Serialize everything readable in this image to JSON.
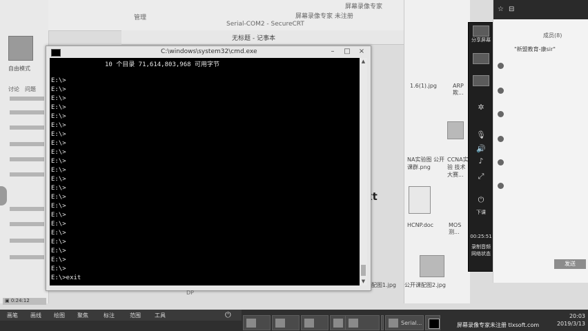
{
  "cmd": {
    "title": "C:\\windows\\system32\\cmd.exe",
    "summary_line": "10 个目录 71,614,803,968 可用字节",
    "prompts": [
      "E:\\>",
      "E:\\>",
      "E:\\>",
      "E:\\>",
      "E:\\>",
      "E:\\>",
      "E:\\>",
      "E:\\>",
      "E:\\>",
      "E:\\>",
      "E:\\>",
      "E:\\>",
      "E:\\>",
      "E:\\>",
      "E:\\>",
      "E:\\>",
      "E:\\>",
      "E:\\>",
      "E:\\>",
      "E:\\>",
      "E:\\>",
      "E:\\>"
    ],
    "last_line": "E:\\>exit",
    "buttons": {
      "minimize": "–",
      "maximize": "□",
      "close": "×"
    }
  },
  "notepad": {
    "title": "无标题 - 记事本"
  },
  "top_strip": {
    "items": [
      "Serial-COM2 - SecureCRT",
      "管理",
      "屏幕录像专家 未注册",
      "屏幕录像专家"
    ]
  },
  "left_pane": {
    "user": "自由模式",
    "tabs": [
      "讨论",
      "问题"
    ]
  },
  "files": [
    {
      "name": "1.6(1).jpg"
    },
    {
      "name": "ARP欺..."
    },
    {
      "name": "NA实验图 公开课群.png"
    },
    {
      "name": "CCNA实验 技术大赛..."
    },
    {
      "name": "HCNP.doc"
    },
    {
      "name": "MOS测..."
    },
    {
      "name": "配图1.jpg"
    },
    {
      "name": "公开课配图2.jpg"
    }
  ],
  "big_letters": [
    "?",
    "xt"
  ],
  "dp_label": "DP",
  "status_left": "▣ 0:24:12",
  "recorder": {
    "labels": [
      "分享屏幕",
      "下课"
    ],
    "timer": "00:25:51",
    "footer": "录制音频 网络状态"
  },
  "chat": {
    "header": [
      "☆",
      "⊟",
      "成员(8)"
    ],
    "group_title": "\"新盟教育-康sir\"",
    "members": [
      "  ",
      "  ",
      "  ",
      "  ",
      "  ",
      "  "
    ],
    "send_label": "发送"
  },
  "taskbar": {
    "menu": [
      "画笔",
      "画线",
      "绘图",
      "聚焦",
      "标注",
      "范围",
      "工具"
    ],
    "tasks": [
      "",
      "",
      "",
      "",
      "",
      "",
      "Serial...",
      ""
    ],
    "tray_time": "20:03",
    "tray_date": "2019/3/13",
    "watermark": "屏幕录像专家未注册 tlxsoft.com"
  }
}
